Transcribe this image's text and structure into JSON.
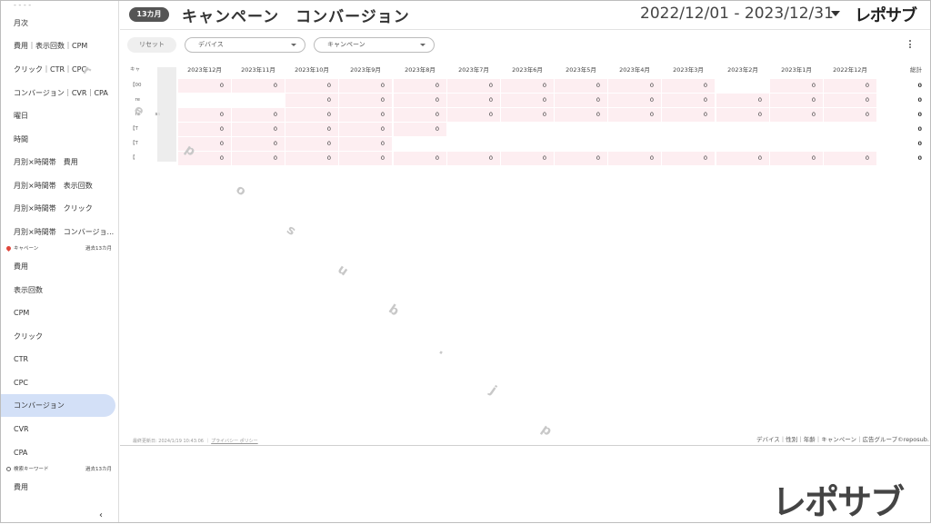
{
  "sidebar": {
    "items_top": [
      "月次",
      "費用｜表示回数｜CPM",
      "クリック｜CTR｜CPC",
      "コンバージョン｜CVR｜CPA",
      "曜日",
      "時間",
      "月別×時間帯　費用",
      "月別×時間帯　表示回数",
      "月別×時間帯　クリック",
      "月別×時間帯　コンバージョ..."
    ],
    "section_campaign": {
      "label": "キャペーン",
      "range": "過去13カ月"
    },
    "items_campaign": [
      "費用",
      "表示回数",
      "CPM",
      "クリック",
      "CTR",
      "CPC",
      "コンバージョン",
      "CVR",
      "CPA"
    ],
    "active_item": "コンバージョン",
    "section_keyword": {
      "label": "検索キーワード",
      "range": "過去13カ月"
    },
    "items_keyword": [
      "費用"
    ],
    "collapse_icon": "‹"
  },
  "header": {
    "badge": "13カ月",
    "title": "キャンペーン　コンバージョン",
    "date_range": "2022/12/01 - 2023/12/31",
    "logo": "レポサブ"
  },
  "filters": {
    "reset_label": "リセット",
    "device_label": "デバイス",
    "campaign_label": "キャンペーン"
  },
  "table": {
    "first_header": "キャ",
    "columns": [
      "2023年12月",
      "2023年11月",
      "2023年10月",
      "2023年9月",
      "2023年8月",
      "2023年7月",
      "2023年6月",
      "2023年5月",
      "2023年4月",
      "2023年3月",
      "2023年2月",
      "2023年1月",
      "2022年12月"
    ],
    "total_header": "総計",
    "rows": [
      {
        "label": "【00",
        "cells": [
          "0",
          "0",
          "0",
          "0",
          "0",
          "0",
          "0",
          "0",
          "0",
          "0",
          "",
          "0",
          "0"
        ],
        "total": "0"
      },
      {
        "label": "　re",
        "cells": [
          "",
          "",
          "0",
          "0",
          "0",
          "0",
          "0",
          "0",
          "0",
          "0",
          "0",
          "0",
          "0"
        ],
        "total": "0"
      },
      {
        "label": "　re　　　ss",
        "cells": [
          "0",
          "0",
          "0",
          "0",
          "0",
          "0",
          "0",
          "0",
          "0",
          "0",
          "0",
          "0",
          "0"
        ],
        "total": "0"
      },
      {
        "label": "【T",
        "cells": [
          "0",
          "0",
          "0",
          "0",
          "0",
          "",
          "",
          "",
          "",
          "",
          "",
          "",
          ""
        ],
        "total": "0"
      },
      {
        "label": "【T",
        "cells": [
          "0",
          "0",
          "0",
          "0",
          "",
          "",
          "",
          "",
          "",
          "",
          "",
          "",
          ""
        ],
        "total": "0"
      },
      {
        "label": "【　",
        "cells": [
          "0",
          "0",
          "0",
          "0",
          "0",
          "0",
          "0",
          "0",
          "0",
          "0",
          "0",
          "0",
          "0"
        ],
        "total": "0"
      }
    ]
  },
  "footer": {
    "updated": "最終更新日: 2024/1/19 10:43:06",
    "privacy": "プライバシー ポリシー",
    "breadcrumb": "デバイス｜性別｜年齢｜キャンペーン｜広告グループ©reposub."
  },
  "watermark": [
    "r",
    "e",
    "p",
    "o",
    "s",
    "u",
    "b",
    ".",
    "j",
    "p"
  ],
  "brand_logo": "レポサブ"
}
